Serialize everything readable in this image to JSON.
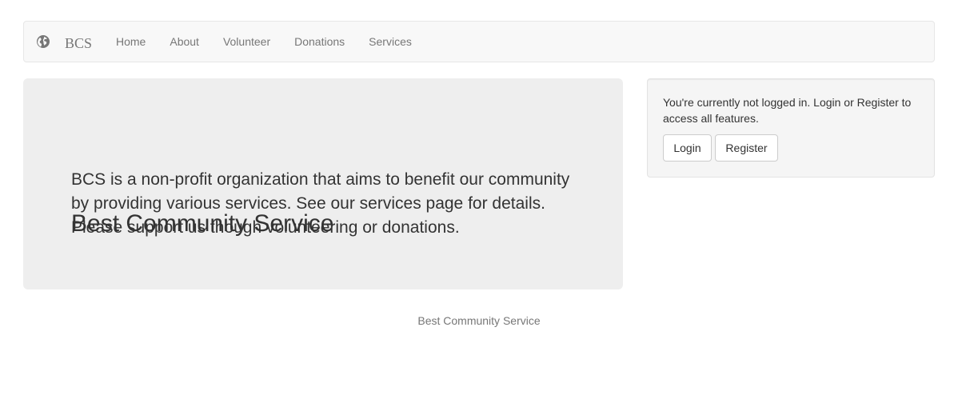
{
  "navbar": {
    "brand_icon": "globe-icon",
    "brand": "BCS",
    "items": [
      {
        "label": "Home"
      },
      {
        "label": "About"
      },
      {
        "label": "Volunteer"
      },
      {
        "label": "Donations"
      },
      {
        "label": "Services"
      }
    ]
  },
  "jumbotron": {
    "title": "Best Community Service",
    "text": "BCS is a non-profit organization that aims to benefit our community by providing various services. See our services page for details. Please support us though volunteering or donations."
  },
  "auth_panel": {
    "message": "You're currently not logged in. Login or Register to access all features.",
    "login_label": "Login",
    "register_label": "Register"
  },
  "footer": {
    "text": "Best Community Service"
  },
  "colors": {
    "navbar_bg": "#f8f8f8",
    "jumbotron_bg": "#eeeeee",
    "panel_bg": "#f5f5f5",
    "nav_text": "#777777",
    "body_text": "#333333"
  }
}
